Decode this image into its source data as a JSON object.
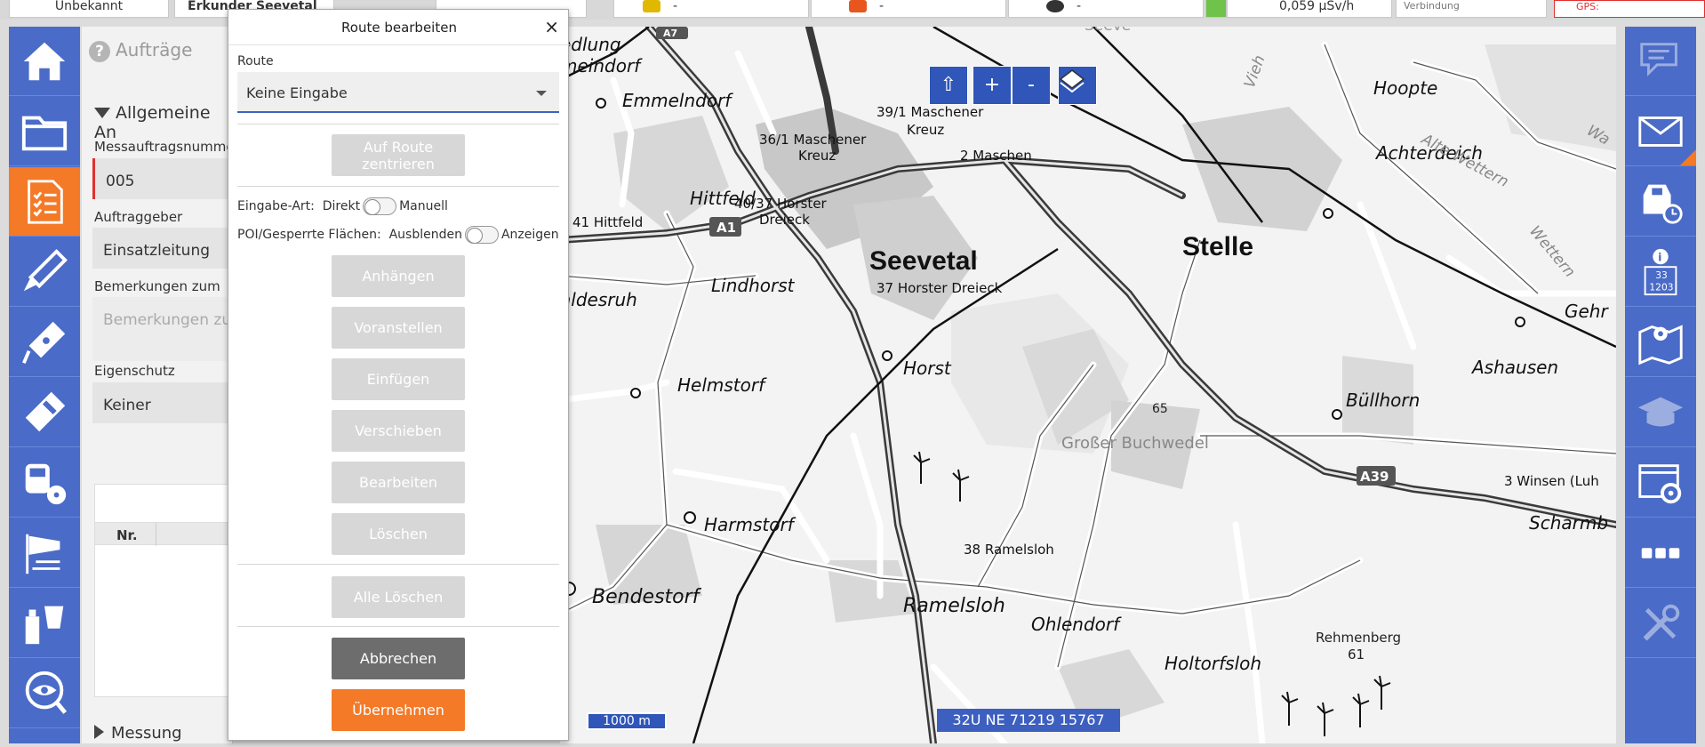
{
  "topbar": {
    "cell_status": "Unbekannt",
    "cell_unit": "Erkunder Seevetal",
    "cell_dev1": "-",
    "cell_dev2": "-",
    "cell_dev3": "-",
    "cell_doserate": "0,059 µSv/h",
    "cell_misc": "Verbindung",
    "cell_gps": "GPS:",
    "dev1_color": "#e0b800",
    "dev2_color": "#e8561e",
    "dev3_color": "#333333",
    "dose_color": "#6fc24a"
  },
  "left_sidebar": {
    "items": [
      {
        "icon": "home-icon"
      },
      {
        "icon": "folder-icon"
      },
      {
        "icon": "orders-list-icon",
        "active": true
      },
      {
        "icon": "probe-icon"
      },
      {
        "icon": "dosimeter-probe-icon"
      },
      {
        "icon": "measuring-device-icon"
      },
      {
        "icon": "radiation-meter-icon"
      },
      {
        "icon": "windsock-icon"
      },
      {
        "icon": "sampling-icon"
      },
      {
        "icon": "eye-icon"
      }
    ]
  },
  "right_sidebar": {
    "items": [
      {
        "icon": "chat-icon",
        "dim": true
      },
      {
        "icon": "mail-icon"
      },
      {
        "icon": "vehicle-timer-icon"
      },
      {
        "icon": "info-icon",
        "numbers": "33\n1203"
      },
      {
        "icon": "map-pin-icon"
      },
      {
        "icon": "training-cap-icon",
        "dim": true
      },
      {
        "icon": "window-settings-icon"
      },
      {
        "icon": "more-icon"
      },
      {
        "icon": "tools-icon",
        "dim": true
      }
    ]
  },
  "orders_panel": {
    "title": "Aufträge",
    "section_general": "Allgemeine An",
    "label_order_no": "Messauftragsnummer",
    "value_order_no": "005",
    "label_client": "Auftraggeber",
    "value_client": "Einsatzleitung",
    "label_remarks": "Bemerkungen zum Au",
    "placeholder_remarks": "Bemerkungen zur",
    "label_protection": "Eigenschutz",
    "value_protection": "Keiner",
    "table_col_nr": "Nr.",
    "section_measure": "Messung"
  },
  "dialog": {
    "title": "Route bearbeiten",
    "close": "×",
    "route_label": "Route",
    "route_value": "Keine Eingabe",
    "btn_center": "Auf Route zentrieren",
    "input_mode_label": "Eingabe-Art:",
    "input_mode_left": "Direkt",
    "input_mode_right": "Manuell",
    "poi_label": "POI/Gesperrte Flächen:",
    "poi_left": "Ausblenden",
    "poi_right": "Anzeigen",
    "btn_append": "Anhängen",
    "btn_prepend": "Voranstellen",
    "btn_insert": "Einfügen",
    "btn_move": "Verschieben",
    "btn_edit": "Bearbeiten",
    "btn_delete": "Löschen",
    "btn_delete_all": "Alle Löschen",
    "btn_cancel": "Abbrechen",
    "btn_apply": "Übernehmen"
  },
  "map": {
    "btn_up": "⇧",
    "btn_zoom_in": "+",
    "btn_zoom_out": "-",
    "scale": "1000 m",
    "coordinates": "32U NE 71219 15767",
    "labels": {
      "seevetal": "Seevetal",
      "stelle": "Stelle",
      "emmelndorf": "Emmelndorf",
      "hittfeld": "Hittfeld",
      "lindhorst": "Lindhorst",
      "helmstorf": "Helmstorf",
      "harmstorf": "Harmstorf",
      "bendestorf": "Bendestorf",
      "ramelsloh": "Ramelsloh",
      "ohlendorf": "Ohlendorf",
      "holtorfsloh": "Holtorfsloh",
      "horst": "Horst",
      "hoopte": "Hoopte",
      "achterdeich": "Achterdeich",
      "ashausen": "Ashausen",
      "buellhorn": "Büllhorn",
      "scharmb": "Scharmb",
      "gehr": "Gehr",
      "aldesruh": "aldesruh",
      "edlung": "edlung",
      "meindorf": "meindorf",
      "grosser_buchwedel": "Großer Buchwedel",
      "rehmenberg": "Rehmenberg",
      "rehmenberg_h": "61",
      "elev_65": "65",
      "j391": "39/1 Maschener",
      "j391b": "Kreuz",
      "j361": "36/1 Maschener",
      "j361b": "Kreuz",
      "j2": "2 Maschen",
      "j4037": "40/37 Horster",
      "j4037b": "Dreieck",
      "j41": "41 Hittfeld",
      "j37": "37 Horster Dreieck",
      "j38": "38 Ramelsloh",
      "j3": "3 Winsen (Luh",
      "a1": "A1",
      "a7": "A7",
      "a39": "A39",
      "alte_wettern": "Alte Wettern",
      "wettern": "Wettern",
      "wa": "Wa",
      "vieh": "Vieh",
      "seeve": "Seeve"
    }
  }
}
